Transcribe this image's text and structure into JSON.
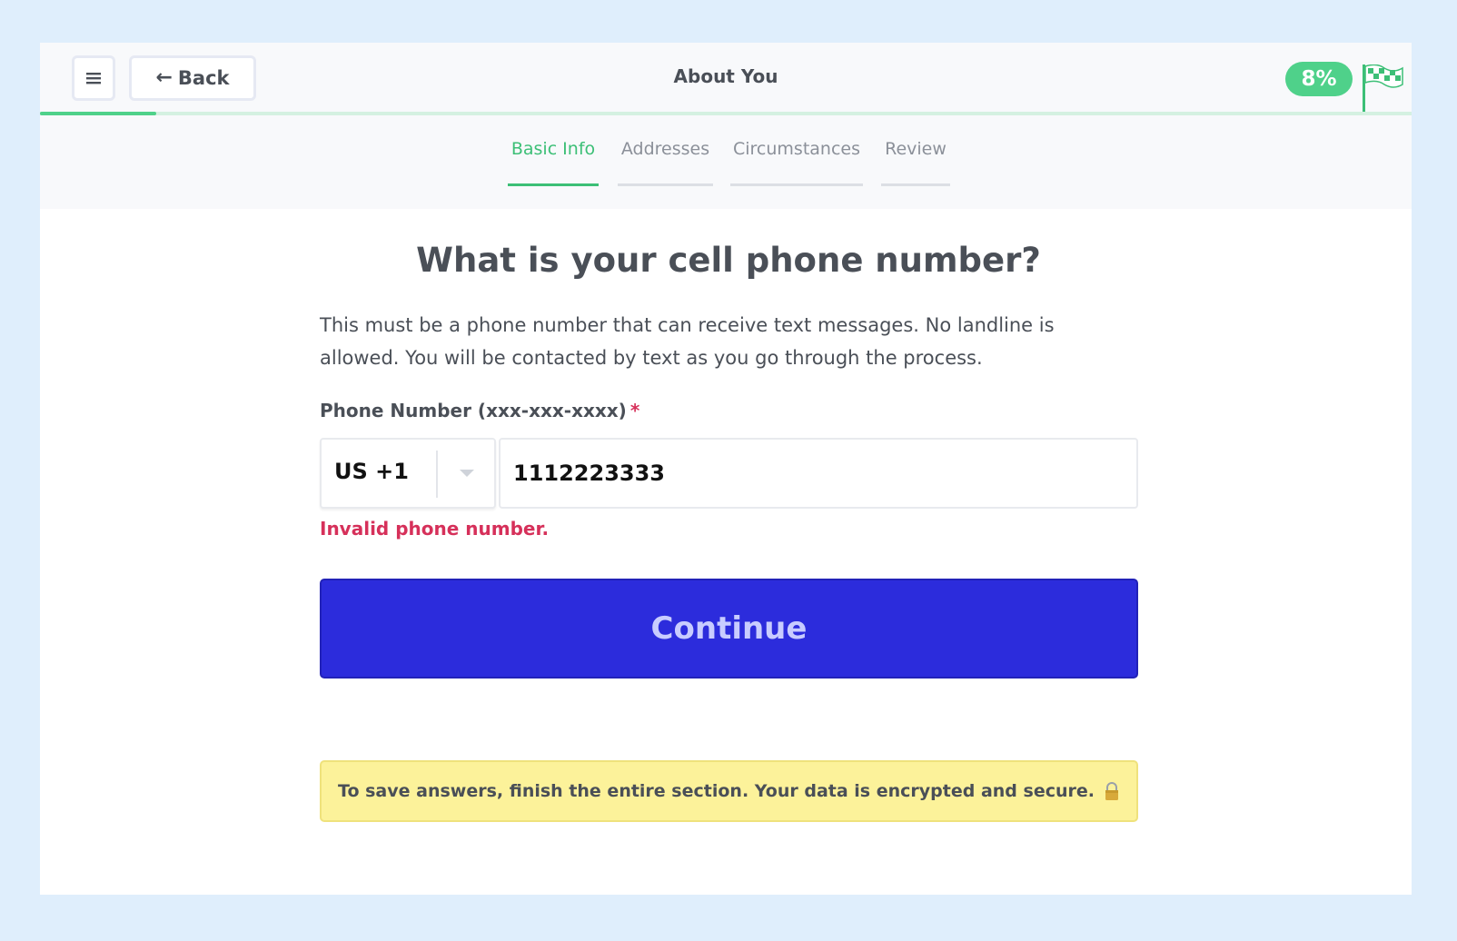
{
  "header": {
    "back_label": "Back",
    "back_arrow": "←",
    "title": "About You",
    "progress_percent_label": "8%",
    "progress_fraction": 0.085
  },
  "tabs": [
    {
      "label": "Basic Info",
      "active": true
    },
    {
      "label": "Addresses",
      "active": false
    },
    {
      "label": "Circumstances",
      "active": false
    },
    {
      "label": "Review",
      "active": false
    }
  ],
  "form": {
    "question": "What is your cell phone number?",
    "helper_text": "This must be a phone number that can receive text messages. No landline is allowed. You will be contacted by text as you go through the process.",
    "field_label": "Phone Number (xxx-xxx-xxxx)",
    "required_marker": "*",
    "country_code": "US +1",
    "phone_value": "1112223333",
    "error": "Invalid phone number.",
    "continue_label": "Continue"
  },
  "notice": {
    "text": "To save answers, finish the entire section. Your data is encrypted and secure.",
    "icon": "lock-icon"
  },
  "colors": {
    "accent_green": "#4fd18a",
    "primary_button": "#2c2cdc",
    "error_red": "#d6305a",
    "notice_yellow": "#fcf29a"
  }
}
